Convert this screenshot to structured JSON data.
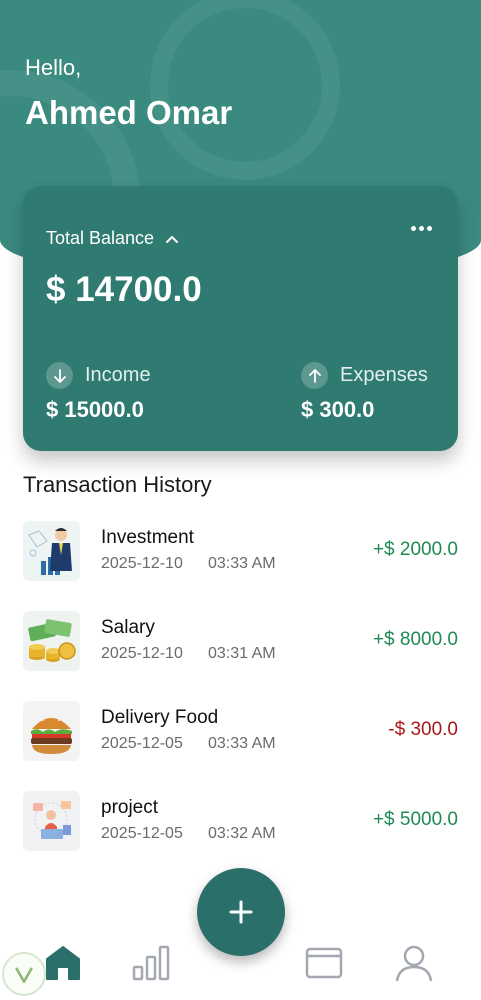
{
  "greeting": "Hello,",
  "user": {
    "name": "Ahmed Omar"
  },
  "balance_card": {
    "label": "Total Balance",
    "amount": "$ 14700.0",
    "income": {
      "label": "Income",
      "amount": "$ 15000.0"
    },
    "expenses": {
      "label": "Expenses",
      "amount": "$ 300.0"
    }
  },
  "transactions_section": {
    "title": "Transaction History",
    "items": [
      {
        "title": "Investment",
        "date": "2025-12-10",
        "time": "03:33 AM",
        "amount": "+$ 2000.0",
        "type": "income",
        "icon": "investment-icon"
      },
      {
        "title": "Salary",
        "date": "2025-12-10",
        "time": "03:31 AM",
        "amount": "+$ 8000.0",
        "type": "income",
        "icon": "salary-icon"
      },
      {
        "title": "Delivery Food",
        "date": "2025-12-05",
        "time": "03:33 AM",
        "amount": "-$ 300.0",
        "type": "expense",
        "icon": "burger-icon"
      },
      {
        "title": "project",
        "date": "2025-12-05",
        "time": "03:32 AM",
        "amount": "+$ 5000.0",
        "type": "income",
        "icon": "project-icon"
      }
    ]
  },
  "nav": {
    "items": [
      {
        "name": "home",
        "active": true
      },
      {
        "name": "statistics",
        "active": false
      },
      {
        "name": "wallet",
        "active": false
      },
      {
        "name": "profile",
        "active": false
      }
    ]
  },
  "colors": {
    "primary": "#3a8a80",
    "card": "#2f7a71",
    "fab": "#2b6f6a",
    "income": "#1f8a55",
    "expense": "#a81818"
  }
}
